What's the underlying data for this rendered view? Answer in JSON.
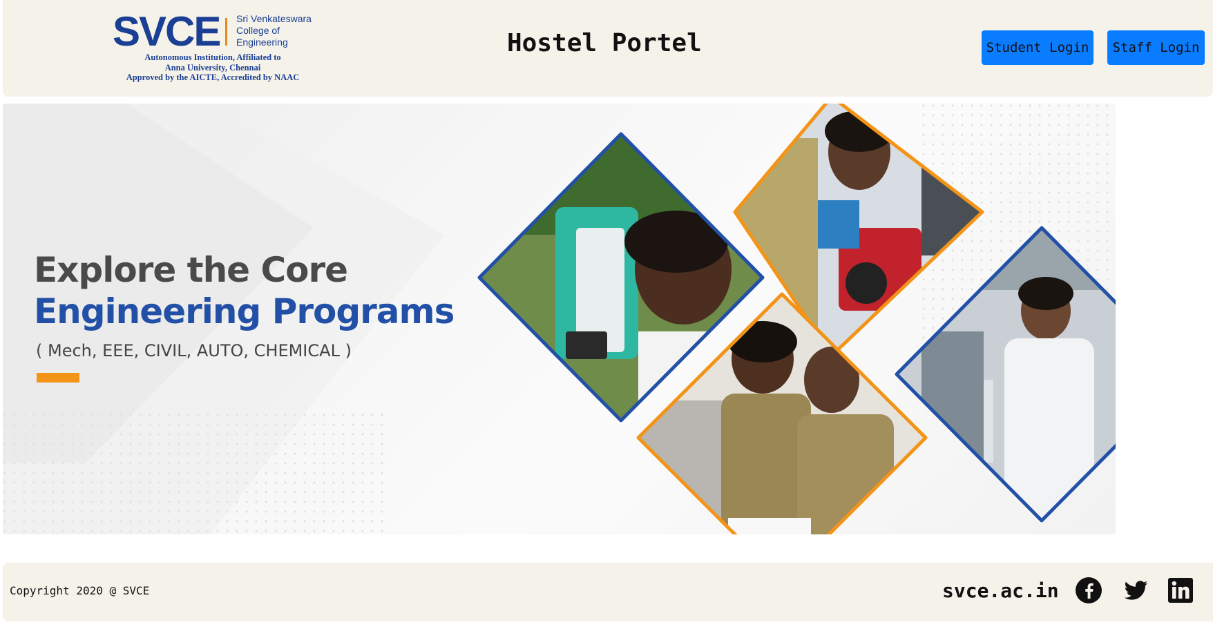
{
  "header": {
    "logo": {
      "wordmark": "SVCE",
      "institute_lines": [
        "Sri Venkateswara",
        "College of",
        "Engineering"
      ],
      "tagline_lines": [
        "Autonomous Institution, Affiliated to",
        "Anna University, Chennai",
        "Approved by the AICTE, Accredited by NAAC"
      ]
    },
    "title": "Hostel Portel",
    "student_login_label": "Student Login",
    "staff_login_label": "Staff Login"
  },
  "banner": {
    "heading_line_1": "Explore the Core",
    "heading_line_2": "Engineering Programs",
    "programs": "( Mech, EEE, CIVIL, AUTO, CHEMICAL )"
  },
  "footer": {
    "copyright": "Copyright 2020 @ SVCE",
    "site": "svce.ac.in",
    "social": [
      "facebook-icon",
      "twitter-icon",
      "linkedin-icon"
    ]
  },
  "colors": {
    "header_bg": "#f5f2ea",
    "button_bg": "#0a7cff",
    "brand_blue": "#2250a6",
    "accent_orange": "#f39418"
  }
}
